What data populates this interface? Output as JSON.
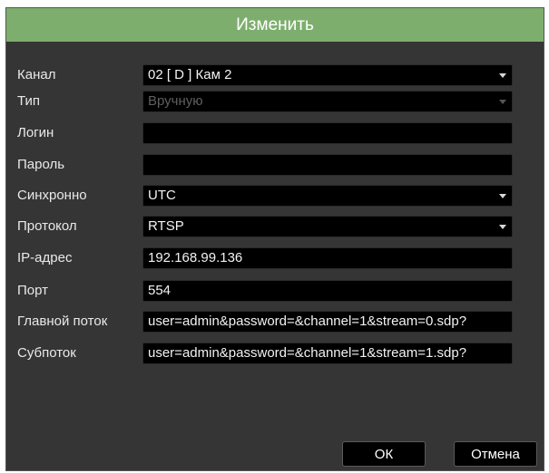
{
  "dialog": {
    "title": "Изменить"
  },
  "form": {
    "channel": {
      "label": "Канал",
      "value": "02 [ D ] Кам 2"
    },
    "type": {
      "label": "Тип",
      "value": "Вручную"
    },
    "login": {
      "label": "Логин",
      "value": ""
    },
    "password": {
      "label": "Пароль",
      "value": ""
    },
    "sync": {
      "label": "Синхронно",
      "value": "UTC"
    },
    "protocol": {
      "label": "Протокол",
      "value": "RTSP"
    },
    "ip": {
      "label": "IP-адрес",
      "value": "192.168.99.136"
    },
    "port": {
      "label": "Порт",
      "value": "554"
    },
    "mainstream": {
      "label": "Главной поток",
      "value": "user=admin&password=&channel=1&stream=0.sdp?"
    },
    "substream": {
      "label": "Субпоток",
      "value": "user=admin&password=&channel=1&stream=1.sdp?"
    }
  },
  "buttons": {
    "ok": "ОК",
    "cancel": "Отмена"
  },
  "colors": {
    "title_bar": "#7dae6d",
    "dialog_bg": "#353535",
    "field_bg": "#000000"
  }
}
